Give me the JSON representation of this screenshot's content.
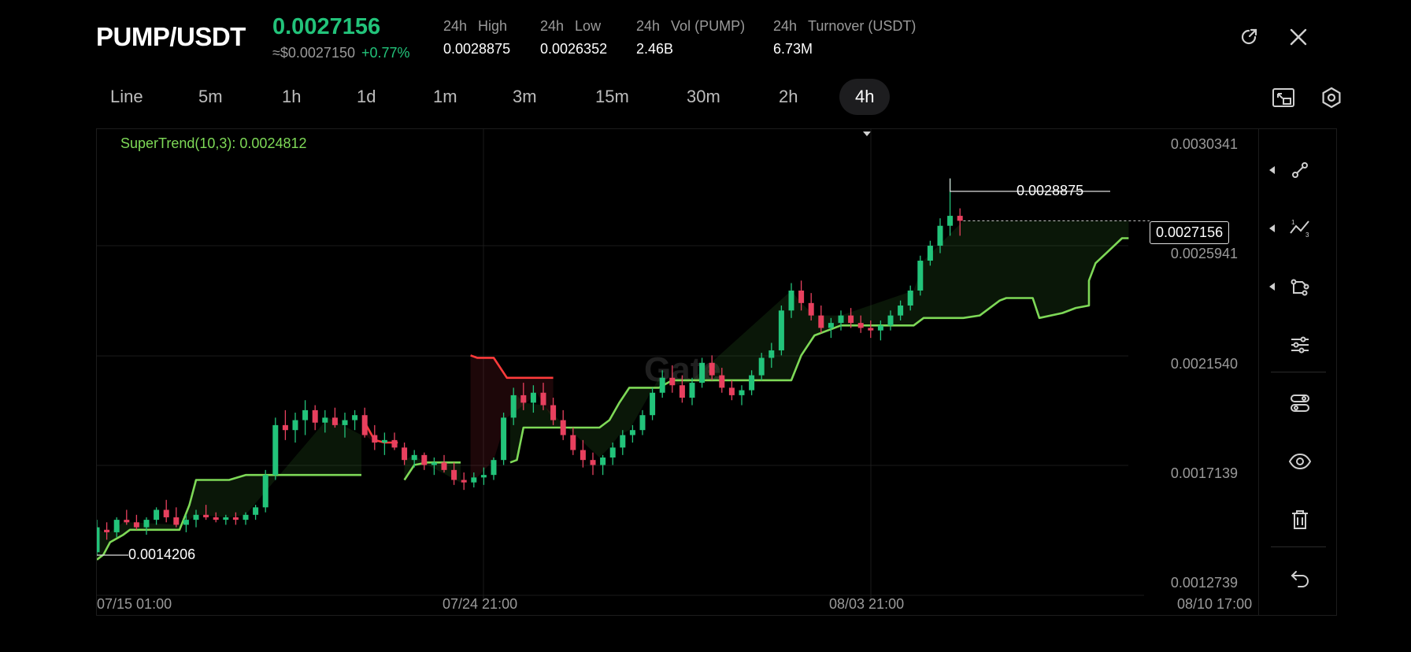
{
  "header": {
    "pair": "PUMP/USDT",
    "last_price": "0.0027156",
    "usd_price": "≈$0.0027150",
    "change": "+0.77%",
    "stats": [
      {
        "period": "24h",
        "label": "High",
        "value": "0.0028875"
      },
      {
        "period": "24h",
        "label": "Low",
        "value": "0.0026352"
      },
      {
        "period": "24h",
        "label": "Vol (PUMP)",
        "value": "2.46B"
      },
      {
        "period": "24h",
        "label": "Turnover (USDT)",
        "value": "6.73M"
      }
    ],
    "icons": [
      "external-link-icon",
      "close-icon"
    ]
  },
  "timeframes": {
    "items": [
      "Line",
      "5m",
      "1h",
      "1d",
      "1m",
      "3m",
      "15m",
      "30m",
      "2h",
      "4h"
    ],
    "active": "4h"
  },
  "toolbar_icons": [
    "fullscreen-icon",
    "settings-hexagon-icon"
  ],
  "chart": {
    "indicator": "SuperTrend(10,3): 0.0024812",
    "watermark": "Gate",
    "y_ticks": [
      "0.0030341",
      "0.0025941",
      "0.0021540",
      "0.0017139",
      "0.0012739"
    ],
    "x_ticks": [
      "07/15 01:00",
      "07/24 21:00",
      "08/03 21:00",
      "08/10 17:00"
    ],
    "current_price_tag": "0.0027156",
    "high_marker": "0.0028875",
    "low_marker": "0.0014206"
  },
  "sidebar": {
    "tools": [
      "line-tool-icon",
      "fib-tool-icon",
      "shape-tool-icon",
      "indicator-adjust-icon",
      "layers-adjust-icon",
      "visibility-eye-icon",
      "trash-icon",
      "undo-icon"
    ]
  },
  "colors": {
    "up": "#22c37a",
    "down": "#e8405e",
    "supertrend_up": "#7ed957",
    "supertrend_down": "#ff3b3b",
    "price_green": "#22c37a"
  },
  "chart_data": {
    "type": "candlestick",
    "y_range": [
      0.0012739,
      0.0030341
    ],
    "x_ticks": [
      "07/15 01:00",
      "07/24 21:00",
      "08/03 21:00",
      "08/10 17:00"
    ],
    "supertrend": {
      "name": "SuperTrend(10,3)",
      "up_segments": [
        [
          [
            0,
            0.00136
          ],
          [
            2,
            0.00138
          ],
          [
            4,
            0.00143
          ],
          [
            8,
            0.00146
          ],
          [
            10,
            0.00148
          ],
          [
            25,
            0.00148
          ],
          [
            28,
            0.00158
          ],
          [
            30,
            0.00168
          ],
          [
            40,
            0.00168
          ],
          [
            45,
            0.0017
          ],
          [
            70,
            0.0017
          ],
          [
            80,
            0.0017
          ]
        ],
        [
          [
            93,
            0.00168
          ],
          [
            96,
            0.00174
          ],
          [
            100,
            0.00175
          ],
          [
            110,
            0.00175
          ]
        ],
        [
          [
            125,
            0.00175
          ],
          [
            127,
            0.00176
          ],
          [
            129,
            0.00189
          ],
          [
            135,
            0.00189
          ],
          [
            152,
            0.00189
          ],
          [
            155,
            0.00192
          ],
          [
            158,
            0.00199
          ],
          [
            161,
            0.00205
          ],
          [
            170,
            0.00205
          ],
          [
            174,
            0.00208
          ],
          [
            179,
            0.00208
          ],
          [
            210,
            0.00208
          ],
          [
            213,
            0.00218
          ],
          [
            217,
            0.00226
          ],
          [
            225,
            0.0023
          ],
          [
            247,
            0.0023
          ],
          [
            250,
            0.00233
          ],
          [
            262,
            0.00233
          ],
          [
            267,
            0.00234
          ],
          [
            273,
            0.0024
          ],
          [
            275,
            0.00241
          ],
          [
            283,
            0.00241
          ],
          [
            285,
            0.00233
          ],
          [
            292,
            0.00235
          ],
          [
            296,
            0.00237
          ],
          [
            300,
            0.00238
          ],
          [
            300,
            0.00248
          ],
          [
            302,
            0.00255
          ],
          [
            306,
            0.0026
          ],
          [
            310,
            0.00265
          ],
          [
            312,
            0.00265
          ]
        ]
      ],
      "down_segments": [
        [
          [
            81,
            0.00191
          ],
          [
            84,
            0.00184
          ],
          [
            87,
            0.00183
          ],
          [
            91,
            0.00183
          ]
        ],
        [
          [
            113,
            0.00218
          ],
          [
            115,
            0.00217
          ],
          [
            120,
            0.00217
          ],
          [
            124,
            0.00209
          ],
          [
            130,
            0.00209
          ],
          [
            133,
            0.00209
          ],
          [
            138,
            0.00209
          ]
        ]
      ]
    },
    "candles_ohlc": [
      [
        0,
        0.00139,
        0.00152,
        0.00138,
        0.00149
      ],
      [
        3,
        0.00148,
        0.00151,
        0.00144,
        0.00147
      ],
      [
        6,
        0.00147,
        0.00153,
        0.00145,
        0.00152
      ],
      [
        9,
        0.00152,
        0.00156,
        0.0015,
        0.00151
      ],
      [
        12,
        0.00151,
        0.00154,
        0.00148,
        0.00149
      ],
      [
        15,
        0.00149,
        0.00153,
        0.00146,
        0.00152
      ],
      [
        18,
        0.00152,
        0.00157,
        0.0015,
        0.00156
      ],
      [
        21,
        0.00156,
        0.0016,
        0.00151,
        0.00153
      ],
      [
        24,
        0.00153,
        0.00157,
        0.00149,
        0.0015
      ],
      [
        27,
        0.0015,
        0.00154,
        0.00147,
        0.00152
      ],
      [
        30,
        0.00152,
        0.00156,
        0.00149,
        0.00154
      ],
      [
        33,
        0.00154,
        0.00158,
        0.00152,
        0.00153
      ],
      [
        36,
        0.00153,
        0.00155,
        0.00151,
        0.00152
      ],
      [
        39,
        0.00152,
        0.00154,
        0.0015,
        0.00153
      ],
      [
        42,
        0.00153,
        0.00155,
        0.0015,
        0.00152
      ],
      [
        45,
        0.00152,
        0.00155,
        0.0015,
        0.00154
      ],
      [
        48,
        0.00154,
        0.00158,
        0.00152,
        0.00157
      ],
      [
        51,
        0.00157,
        0.00172,
        0.00155,
        0.0017
      ],
      [
        54,
        0.0017,
        0.00193,
        0.00168,
        0.0019
      ],
      [
        57,
        0.0019,
        0.00196,
        0.00184,
        0.00188
      ],
      [
        60,
        0.00188,
        0.00195,
        0.00183,
        0.00192
      ],
      [
        63,
        0.00192,
        0.002,
        0.00186,
        0.00196
      ],
      [
        66,
        0.00196,
        0.00198,
        0.00188,
        0.00191
      ],
      [
        69,
        0.00191,
        0.00196,
        0.00187,
        0.00193
      ],
      [
        72,
        0.00193,
        0.00197,
        0.00189,
        0.0019
      ],
      [
        75,
        0.0019,
        0.00195,
        0.00185,
        0.00192
      ],
      [
        78,
        0.00192,
        0.00196,
        0.00188,
        0.00194
      ],
      [
        81,
        0.00194,
        0.00197,
        0.00185,
        0.00186
      ],
      [
        84,
        0.00186,
        0.0019,
        0.0018,
        0.00183
      ],
      [
        87,
        0.00183,
        0.00187,
        0.00178,
        0.00184
      ],
      [
        90,
        0.00184,
        0.00187,
        0.0018,
        0.00181
      ],
      [
        93,
        0.00181,
        0.00183,
        0.00174,
        0.00176
      ],
      [
        96,
        0.00176,
        0.0018,
        0.00173,
        0.00178
      ],
      [
        99,
        0.00178,
        0.00179,
        0.00172,
        0.00174
      ],
      [
        102,
        0.00174,
        0.00177,
        0.0017,
        0.00175
      ],
      [
        105,
        0.00175,
        0.00178,
        0.00171,
        0.00172
      ],
      [
        108,
        0.00172,
        0.00175,
        0.00166,
        0.00168
      ],
      [
        111,
        0.00168,
        0.00171,
        0.00164,
        0.00167
      ],
      [
        114,
        0.00167,
        0.00171,
        0.00165,
        0.00169
      ],
      [
        117,
        0.00169,
        0.00173,
        0.00166,
        0.0017
      ],
      [
        120,
        0.0017,
        0.00177,
        0.00168,
        0.00176
      ],
      [
        123,
        0.00176,
        0.00195,
        0.00174,
        0.00193
      ],
      [
        126,
        0.00193,
        0.00205,
        0.0019,
        0.00202
      ],
      [
        129,
        0.00202,
        0.00207,
        0.00196,
        0.00199
      ],
      [
        132,
        0.00199,
        0.00206,
        0.00195,
        0.00203
      ],
      [
        135,
        0.00203,
        0.00207,
        0.00196,
        0.00198
      ],
      [
        138,
        0.00198,
        0.00201,
        0.0019,
        0.00192
      ],
      [
        141,
        0.00192,
        0.00196,
        0.00184,
        0.00186
      ],
      [
        144,
        0.00186,
        0.00189,
        0.00178,
        0.0018
      ],
      [
        147,
        0.0018,
        0.00184,
        0.00173,
        0.00176
      ],
      [
        150,
        0.00176,
        0.00179,
        0.0017,
        0.00174
      ],
      [
        153,
        0.00174,
        0.00178,
        0.0017,
        0.00177
      ],
      [
        156,
        0.00177,
        0.00183,
        0.00174,
        0.00181
      ],
      [
        159,
        0.00181,
        0.00188,
        0.00178,
        0.00186
      ],
      [
        162,
        0.00186,
        0.0019,
        0.00183,
        0.00188
      ],
      [
        165,
        0.00188,
        0.00196,
        0.00186,
        0.00194
      ],
      [
        168,
        0.00194,
        0.00205,
        0.00192,
        0.00203
      ],
      [
        171,
        0.00203,
        0.00212,
        0.00201,
        0.00209
      ],
      [
        174,
        0.00209,
        0.00214,
        0.00203,
        0.00206
      ],
      [
        177,
        0.00206,
        0.0021,
        0.00199,
        0.00201
      ],
      [
        180,
        0.00201,
        0.00209,
        0.00198,
        0.00207
      ],
      [
        183,
        0.00207,
        0.00217,
        0.00205,
        0.00215
      ],
      [
        186,
        0.00215,
        0.00218,
        0.00208,
        0.0021
      ],
      [
        189,
        0.0021,
        0.00213,
        0.00203,
        0.00205
      ],
      [
        192,
        0.00205,
        0.00208,
        0.002,
        0.00202
      ],
      [
        195,
        0.00202,
        0.00206,
        0.00198,
        0.00204
      ],
      [
        198,
        0.00204,
        0.00212,
        0.00202,
        0.0021
      ],
      [
        201,
        0.0021,
        0.00219,
        0.00208,
        0.00217
      ],
      [
        204,
        0.00217,
        0.00223,
        0.00213,
        0.0022
      ],
      [
        207,
        0.0022,
        0.00238,
        0.00218,
        0.00236
      ],
      [
        210,
        0.00236,
        0.00247,
        0.00233,
        0.00244
      ],
      [
        213,
        0.00244,
        0.00248,
        0.00236,
        0.00239
      ],
      [
        216,
        0.00239,
        0.00243,
        0.00232,
        0.00234
      ],
      [
        219,
        0.00234,
        0.00238,
        0.00227,
        0.00229
      ],
      [
        222,
        0.00229,
        0.00233,
        0.00225,
        0.00231
      ],
      [
        225,
        0.00231,
        0.00236,
        0.00228,
        0.00234
      ],
      [
        228,
        0.00234,
        0.00237,
        0.00229,
        0.00231
      ],
      [
        231,
        0.00231,
        0.00234,
        0.00227,
        0.00229
      ],
      [
        234,
        0.00229,
        0.00232,
        0.00225,
        0.00228
      ],
      [
        237,
        0.00228,
        0.00232,
        0.00224,
        0.0023
      ],
      [
        240,
        0.0023,
        0.00236,
        0.00228,
        0.00234
      ],
      [
        243,
        0.00234,
        0.0024,
        0.00232,
        0.00238
      ],
      [
        246,
        0.00238,
        0.00246,
        0.00236,
        0.00244
      ],
      [
        249,
        0.00244,
        0.00258,
        0.00242,
        0.00256
      ],
      [
        252,
        0.00256,
        0.00264,
        0.00254,
        0.00262
      ],
      [
        255,
        0.00262,
        0.00273,
        0.00259,
        0.0027
      ],
      [
        258,
        0.0027,
        0.00289,
        0.00266,
        0.00274
      ],
      [
        261,
        0.00274,
        0.00277,
        0.00266,
        0.00272
      ]
    ]
  }
}
